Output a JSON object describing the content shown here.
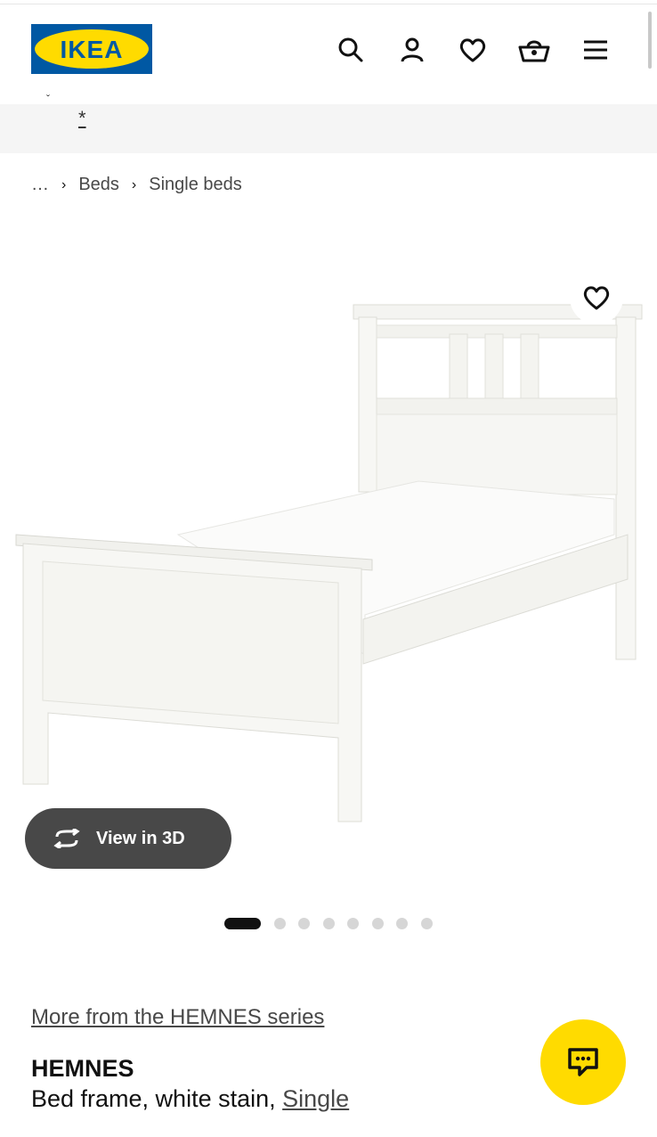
{
  "brand": {
    "logo_text": "IKEA",
    "logo_bg": "#0058a3",
    "logo_fg": "#ffdb00"
  },
  "header": {
    "icons": [
      "search-icon",
      "user-icon",
      "heart-icon",
      "basket-icon",
      "menu-icon"
    ]
  },
  "banner": {
    "caret": "ˇ",
    "star": "*"
  },
  "breadcrumb": {
    "items": [
      "…",
      "Beds",
      "Single beds"
    ],
    "separator": "›"
  },
  "gallery": {
    "view3d_label": "View in 3D",
    "dot_count": 8,
    "active_index": 0
  },
  "product": {
    "series_link": "More from the HEMNES series",
    "name": "HEMNES",
    "description_prefix": "Bed frame, white stain, ",
    "size_link": "Single"
  },
  "chat": {
    "icon": "chat-icon",
    "color": "#ffdb00"
  }
}
